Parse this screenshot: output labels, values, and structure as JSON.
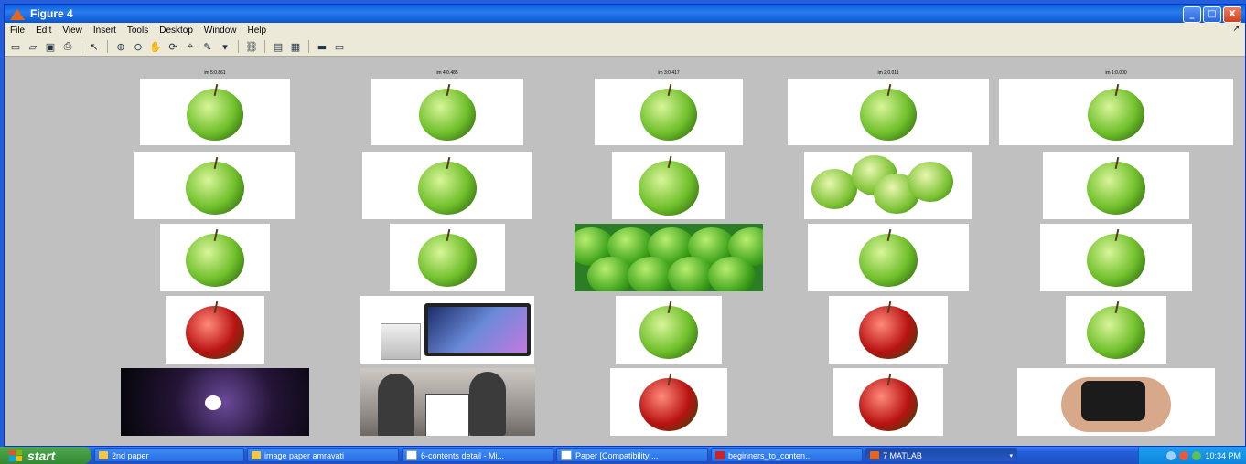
{
  "window": {
    "title": "Figure 4",
    "controls": {
      "minimize": "_",
      "maximize": "□",
      "close": "X"
    }
  },
  "menu": [
    "File",
    "Edit",
    "View",
    "Insert",
    "Tools",
    "Desktop",
    "Window",
    "Help"
  ],
  "menu_overflow": "↗",
  "toolbar_icons": [
    "new-figure-icon",
    "open-file-icon",
    "save-icon",
    "print-icon",
    "separator",
    "edit-plot-arrow-icon",
    "separator",
    "zoom-in-icon",
    "zoom-out-icon",
    "pan-hand-icon",
    "rotate-3d-icon",
    "data-cursor-icon",
    "brush-icon",
    "brush-dropdown-icon",
    "separator",
    "link-plot-icon",
    "separator",
    "colorbar-icon",
    "legend-icon",
    "separator",
    "hide-plot-tools-icon",
    "show-plot-tools-icon"
  ],
  "figure": {
    "rows": [
      [
        {
          "title": "im 5:0.861",
          "image": "green-apple"
        },
        {
          "title": "im 4:0.485",
          "image": "green-apple"
        },
        {
          "title": "im 3:0.417",
          "image": "green-apple"
        },
        {
          "title": "im 2:0.011",
          "image": "green-apple"
        },
        {
          "title": "im 1:0.000",
          "image": "green-apple"
        }
      ],
      [
        {
          "title": "",
          "image": "green-apple-wet"
        },
        {
          "title": "",
          "image": "green-apple-wet"
        },
        {
          "title": "",
          "image": "green-apple-dewy"
        },
        {
          "title": "",
          "image": "green-apples-sliced"
        },
        {
          "title": "",
          "image": "green-apple"
        }
      ],
      [
        {
          "title": "",
          "image": "green-apple"
        },
        {
          "title": "",
          "image": "green-apple"
        },
        {
          "title": "",
          "image": "green-apples-pile"
        },
        {
          "title": "",
          "image": "green-apple"
        },
        {
          "title": "",
          "image": "green-apple"
        }
      ],
      [
        {
          "title": "",
          "image": "red-apple"
        },
        {
          "title": "",
          "image": "imac-computer"
        },
        {
          "title": "",
          "image": "green-apple"
        },
        {
          "title": "",
          "image": "red-apple"
        },
        {
          "title": "",
          "image": "green-apple"
        }
      ],
      [
        {
          "title": "",
          "image": "apple-logo-dark"
        },
        {
          "title": "",
          "image": "iphone-promo-photo"
        },
        {
          "title": "",
          "image": "red-apple"
        },
        {
          "title": "",
          "image": "red-apple"
        },
        {
          "title": "",
          "image": "apple-tv-device"
        }
      ]
    ]
  },
  "taskbar": {
    "start_label": "start",
    "tasks": [
      {
        "label": "2nd paper",
        "icon": "folder-icon"
      },
      {
        "label": "image paper amravati",
        "icon": "folder-icon"
      },
      {
        "label": "6-contents detail - Mi...",
        "icon": "word-doc-icon"
      },
      {
        "label": "Paper [Compatibility ...",
        "icon": "word-doc-icon"
      },
      {
        "label": "beginners_to_conten...",
        "icon": "pdf-icon"
      },
      {
        "label": "7 MATLAB",
        "icon": "matlab-icon",
        "active": true
      }
    ],
    "clock": "10:34 PM"
  }
}
